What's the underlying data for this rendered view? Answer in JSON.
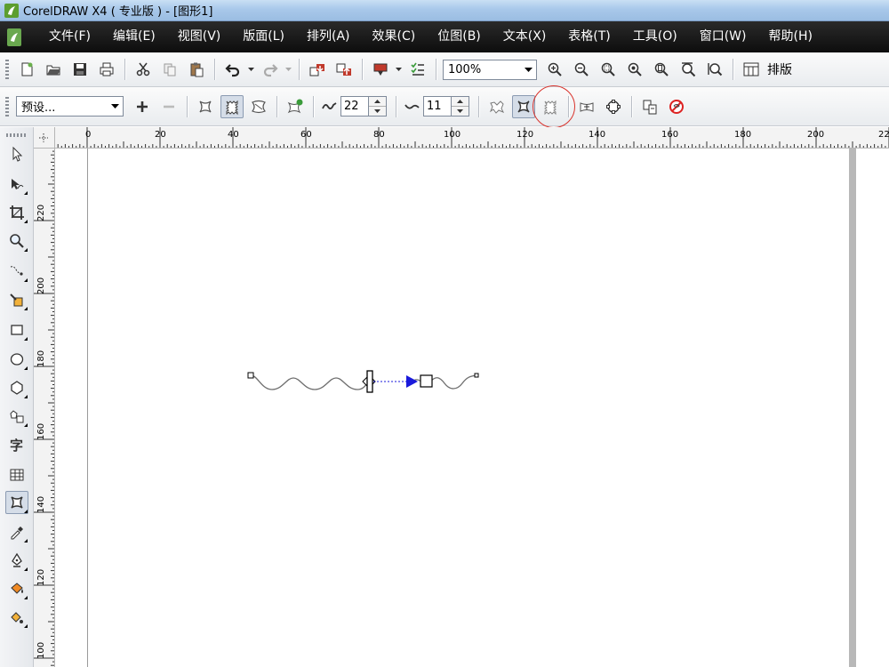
{
  "window": {
    "title": "CorelDRAW X4 ( 专业版 ) - [图形1]"
  },
  "menu": {
    "items": [
      {
        "id": "file",
        "label": "文件(F)"
      },
      {
        "id": "edit",
        "label": "编辑(E)"
      },
      {
        "id": "view",
        "label": "视图(V)"
      },
      {
        "id": "layout",
        "label": "版面(L)"
      },
      {
        "id": "arrange",
        "label": "排列(A)"
      },
      {
        "id": "effects",
        "label": "效果(C)"
      },
      {
        "id": "bitmaps",
        "label": "位图(B)"
      },
      {
        "id": "text",
        "label": "文本(X)"
      },
      {
        "id": "table",
        "label": "表格(T)"
      },
      {
        "id": "tools",
        "label": "工具(O)"
      },
      {
        "id": "window",
        "label": "窗口(W)"
      },
      {
        "id": "help",
        "label": "帮助(H)"
      }
    ]
  },
  "standard_toolbar": {
    "zoom_value": "100%",
    "layout_label": "排版"
  },
  "property_bar": {
    "preset_value": "预设...",
    "amplitude_value": "22",
    "frequency_value": "11"
  },
  "rulers": {
    "horizontal_labels": [
      "0",
      "20",
      "40",
      "60",
      "80",
      "100",
      "120",
      "140",
      "160",
      "180",
      "200",
      "22"
    ],
    "vertical_labels": [
      "220",
      "200",
      "180",
      "160",
      "140",
      "120",
      "100"
    ]
  },
  "colors": {
    "accent_highlight": "#d9332c",
    "distortion_handle": "#1a1adb",
    "menu_background": "#111111"
  }
}
